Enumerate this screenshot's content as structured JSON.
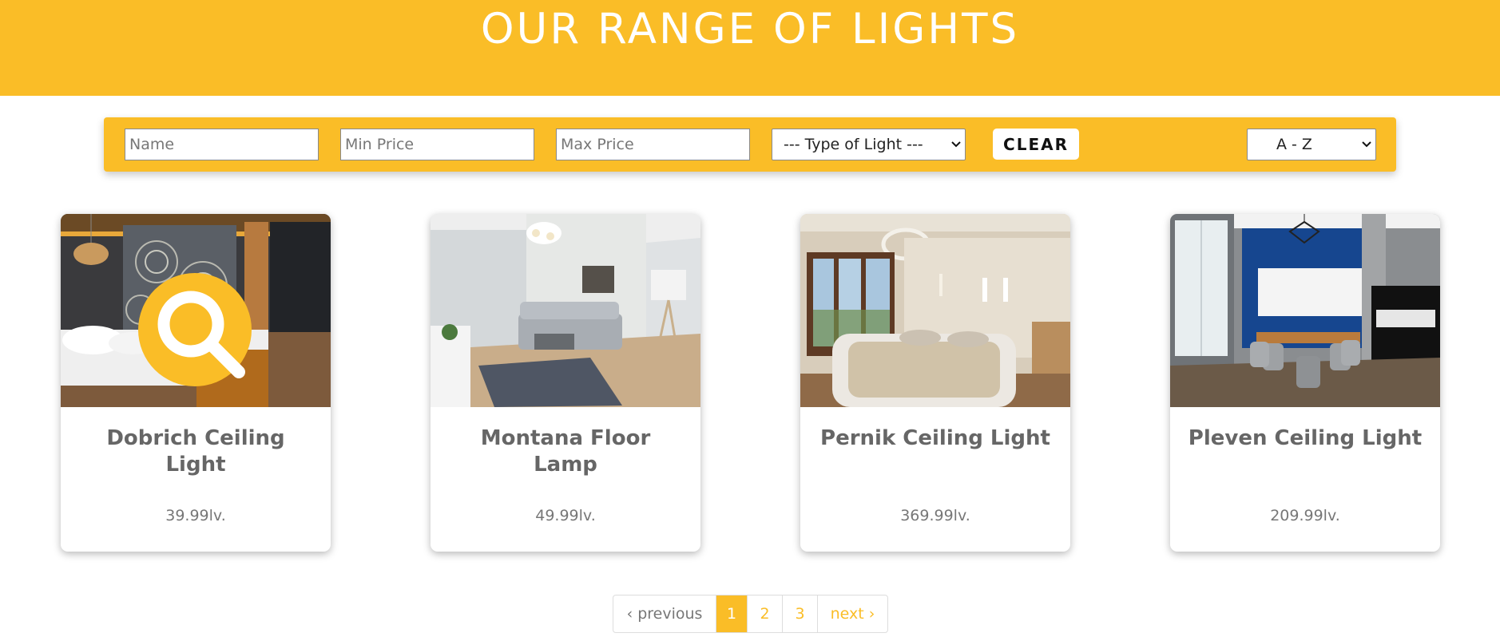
{
  "header": {
    "title": "OUR RANGE OF LIGHTS"
  },
  "filters": {
    "name_placeholder": "Name",
    "min_price_placeholder": "Min Price",
    "max_price_placeholder": "Max Price",
    "type_select_value": "--- Type of Light ---",
    "clear_label": "CLEAR",
    "sort_select_value": "A - Z"
  },
  "products": [
    {
      "title": "Dobrich Ceiling Light",
      "price": "39.99lv."
    },
    {
      "title": "Montana Floor Lamp",
      "price": "49.99lv."
    },
    {
      "title": "Pernik Ceiling Light",
      "price": "369.99lv."
    },
    {
      "title": "Pleven Ceiling Light",
      "price": "209.99lv."
    }
  ],
  "pagination": {
    "previous_label": "‹ previous",
    "pages": [
      "1",
      "2",
      "3"
    ],
    "current_page": "1",
    "next_label": "next ›"
  },
  "colors": {
    "accent": "#fabd27",
    "text": "#666666"
  },
  "icons": {
    "quick_view": "search-icon",
    "select_arrow": "chevron-down-icon"
  }
}
